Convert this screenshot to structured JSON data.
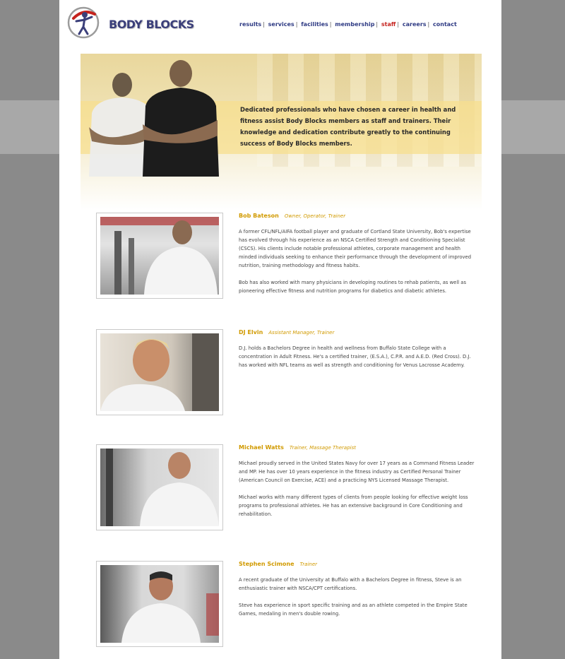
{
  "brand": {
    "name": "BODY BLOCKS"
  },
  "nav": [
    "results",
    "services",
    "facilities",
    "membership",
    "staff",
    "careers",
    "contact"
  ],
  "nav_active": "staff",
  "hero": {
    "text": "Dedicated professionals who have chosen a career in health and fitness assist Body Blocks members as staff and trainers. Their knowledge and dedication contribute greatly to the continuing success of Body Blocks members."
  },
  "staff": [
    {
      "name": "Bob Bateson",
      "role": "Owner, Operator, Trainer",
      "bio": [
        "A former CFL/NFL/AIFA football player and graduate of Cortland State University, Bob's expertise has evolved through his experience as an NSCA Certified Strength and Conditioning Specialist (CSCS). His clients include notable professional athletes, corporate management and health minded individuals seeking to enhance their performance through the development of improved nutrition, training methodology and fitness habits.",
        "Bob has also worked with many physicians in developing routines to rehab patients, as well as pioneering effective fitness and nutrition programs for diabetics and diabetic athletes."
      ]
    },
    {
      "name": "DJ Elvin",
      "role": "Assistant Manager, Trainer",
      "bio": [
        "D.J. holds a Bachelors Degree in health and wellness from Buffalo State College with a concentration in Adult Fitness. He's a certified trainer, (E.S.A.), C.P.R. and A.E.D. (Red Cross). D.J. has worked with NFL teams as well as strength and conditioning for Venus Lacrosse Academy."
      ]
    },
    {
      "name": "Michael Watts",
      "role": "Trainer, Massage Therapist",
      "bio": [
        "Michael proudly served in the United States Navy for over 17 years as a Command Fitness Leader and MP. He has over 10 years experience in the fitness industry as Certified Personal Trainer (American Council on Exercise, ACE) and a practicing NYS Licensed Massage Therapist.",
        "Michael works with many different types of clients from people looking for effective weight loss programs to professional athletes. He has an extensive background in Core Conditioning and rehabilitation."
      ]
    },
    {
      "name": "Stephen Scimone",
      "role": "Trainer",
      "bio": [
        "A recent graduate of the University at Buffalo with a Bachelors Degree in fitness, Steve is an enthusiastic trainer with NSCA/CPT certifications.",
        "Steve has experience in sport specific training and as an athlete competed in the Empire State Games, medaling in men's double rowing."
      ]
    }
  ]
}
